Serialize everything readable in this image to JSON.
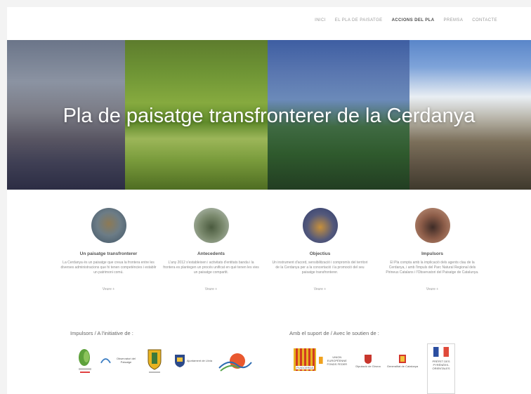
{
  "nav": {
    "items": [
      {
        "label": "INICI",
        "active": false
      },
      {
        "label": "EL PLA DE PAISATGE",
        "active": false
      },
      {
        "label": "ACCIONS DEL PLA",
        "active": true
      },
      {
        "label": "PREMSA",
        "active": false
      },
      {
        "label": "CONTACTE",
        "active": false
      }
    ]
  },
  "hero": {
    "title": "Pla de paisatge transfronterer de la Cerdanya"
  },
  "features": [
    {
      "title": "Un paisatge transfronterer",
      "text": "La Cerdanya és un paisatge que creua la frontera entre les diverses administracions que hi tenen competències i establir un patrimoni comú.",
      "more": "Veure +"
    },
    {
      "title": "Antecedents",
      "text": "L'any 2012 s'estableixen i activitats d'entitats banda i la frontera es plantegen un procés unificat en què tenen les vies un paisatge compartit.",
      "more": "Veure +"
    },
    {
      "title": "Objectius",
      "text": "Un instrument d'acord, sensibilització i compromís del territori de la Cerdanya per a la concertació i la promoció del seu paisatge transfronterer.",
      "more": "Veure +"
    },
    {
      "title": "Impulsors",
      "text": "El Pla compta amb la implicació dels agents clau de la Cerdanya, i amb l'impuls del Parc Natural Regional dels Pirineus Catalans i l'Observatori del Paisatge de Catalunya.",
      "more": "Veure +"
    }
  ],
  "sponsors": {
    "left_heading": "Impulsors / A l'initiative de :",
    "right_heading": "Amb el suport de / Avec le soutien de :",
    "left_logos": [
      {
        "icon": "green-leaf-logo",
        "label": ""
      },
      {
        "icon": "observatori-paisatge-logo",
        "label": "Observatori del Paisatge"
      },
      {
        "icon": "coat-of-arms-logo",
        "label": ""
      },
      {
        "icon": "consell-comarcal-logo",
        "label": "Ajuntament de Llívia"
      },
      {
        "icon": "parc-pyrenees-logo",
        "label": ""
      }
    ],
    "right_logos": [
      {
        "icon": "catalan-stripes-logo",
        "label": "PUIGCERDÀ"
      },
      {
        "icon": "union-europeenne-logo",
        "label": "UNION EUROPÉENNE FONDS FEDER"
      },
      {
        "icon": "diputacio-girona-logo",
        "label": "Diputació de Girona"
      },
      {
        "icon": "generalitat-logo",
        "label": "Generalitat de Catalunya"
      },
      {
        "icon": "republique-francaise-logo",
        "label": "PRÉFET DES PYRÉNÉES-ORIENTALES"
      }
    ]
  }
}
